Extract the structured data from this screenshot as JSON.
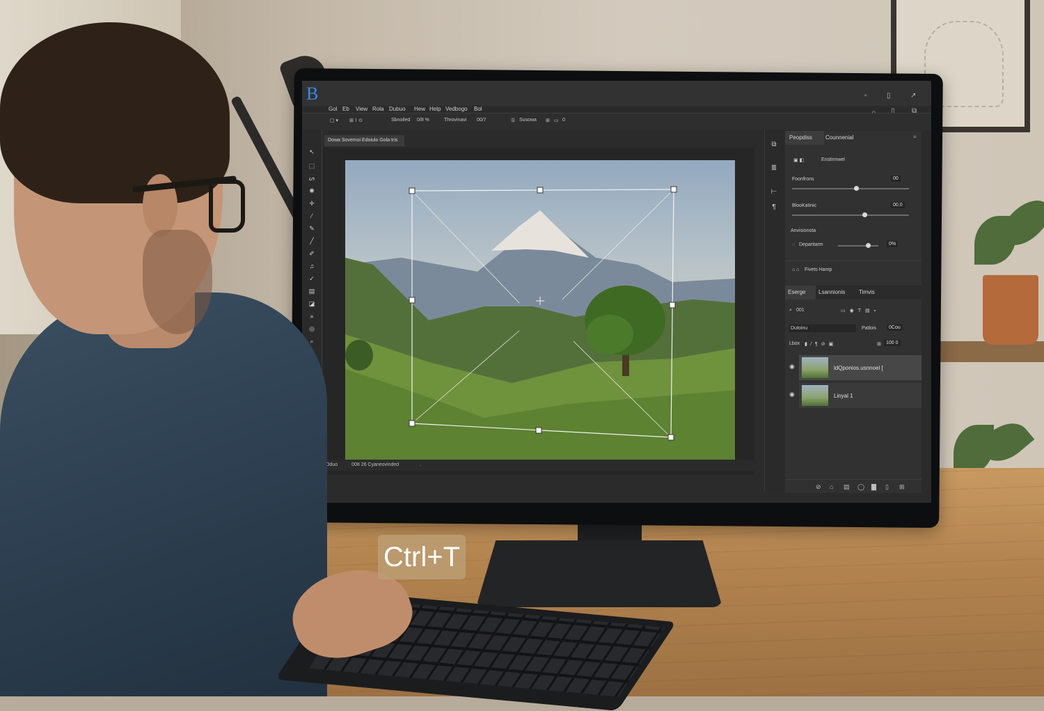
{
  "overlay": {
    "shortcut": "Ctrl+T"
  },
  "app": {
    "logo": "B",
    "menu": [
      "Gol",
      "Eb",
      "View",
      "Rola",
      "Dubuo",
      "Hew",
      "Help",
      "Vedbogo",
      "Bol"
    ],
    "window_controls": [
      "▫",
      "▯",
      "↗"
    ],
    "options_bar": {
      "items": [
        "Sbnoiled",
        "0/8 %",
        "Throvinavi",
        "00/7",
        "Susowa",
        "0"
      ]
    },
    "doc_tab": "Dowa Sovemoi Edoiulo  Gola  tris",
    "status": {
      "zoom": "Oduo",
      "info": "008 26  Cyaneovinded",
      "extra": "."
    },
    "properties": {
      "tabs": [
        "Peopdiss",
        "Counnenial"
      ],
      "header_label": "Enstinnwel",
      "rows": [
        {
          "label": "Foonfrons",
          "value": "00",
          "knob": 0.55
        },
        {
          "label": "BlooKatinic",
          "value": "00.0",
          "knob": 0.62
        }
      ],
      "section_label": "Anvisionota",
      "sub_row": {
        "label": "Deparitarm",
        "value": "0%",
        "knob": 0.75
      },
      "footer_label": "Fivets Hamp"
    },
    "layers": {
      "tabs": [
        "Eserge",
        "Lsannionis",
        "Timvis"
      ],
      "search": "001",
      "blend_mode": "Dutoinu",
      "opacity_label": "Patlois",
      "opacity_value": "0Cou",
      "lock_label": "Lbox",
      "fill_value": "100 0",
      "items": [
        {
          "name": "ldQponios.usnnoel [",
          "selected": true
        },
        {
          "name": "Linyal 1",
          "selected": false
        }
      ]
    }
  }
}
